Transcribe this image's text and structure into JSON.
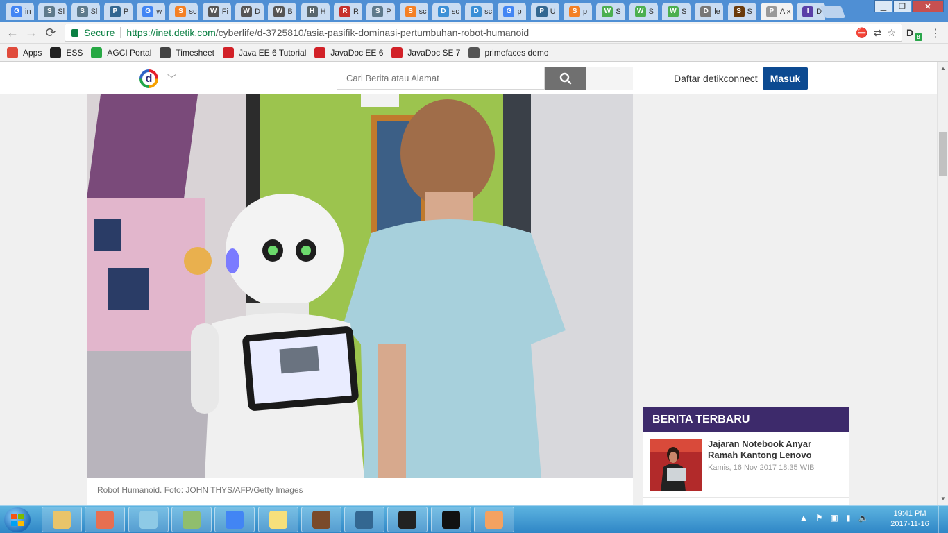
{
  "browser": {
    "tabs": [
      {
        "icon": "google-icon",
        "title": "in",
        "color": "#4285f4"
      },
      {
        "icon": "sonar-icon",
        "title": "Sl",
        "color": "#5e7a8c"
      },
      {
        "icon": "sonar-icon",
        "title": "Sl",
        "color": "#5e7a8c"
      },
      {
        "icon": "postgres-icon",
        "title": "P",
        "color": "#336791"
      },
      {
        "icon": "google-icon",
        "title": "w",
        "color": "#4285f4"
      },
      {
        "icon": "stackoverflow-icon",
        "title": "sc",
        "color": "#f48024"
      },
      {
        "icon": "wikipedia-icon",
        "title": "Fi",
        "color": "#555555"
      },
      {
        "icon": "wikipedia-icon",
        "title": "D",
        "color": "#555555"
      },
      {
        "icon": "wikipedia-icon",
        "title": "B",
        "color": "#555555"
      },
      {
        "icon": "hibernate-icon",
        "title": "H",
        "color": "#59666c"
      },
      {
        "icon": "redis-icon",
        "title": "R",
        "color": "#c6302b"
      },
      {
        "icon": "sonar-icon",
        "title": "P",
        "color": "#5e7a8c"
      },
      {
        "icon": "stackoverflow-icon",
        "title": "sc",
        "color": "#f48024"
      },
      {
        "icon": "db-icon",
        "title": "sc",
        "color": "#3a8fd6"
      },
      {
        "icon": "db-icon",
        "title": "sc",
        "color": "#3a8fd6"
      },
      {
        "icon": "google-icon",
        "title": "p",
        "color": "#4285f4"
      },
      {
        "icon": "postgres-icon",
        "title": "U",
        "color": "#336791"
      },
      {
        "icon": "stackoverflow-icon",
        "title": "p",
        "color": "#f48024"
      },
      {
        "icon": "w3-icon",
        "title": "S",
        "color": "#4caf50"
      },
      {
        "icon": "w3-icon",
        "title": "S",
        "color": "#4caf50"
      },
      {
        "icon": "w3-icon",
        "title": "S",
        "color": "#4caf50"
      },
      {
        "icon": "document-icon",
        "title": "le",
        "color": "#777777"
      },
      {
        "icon": "springio-icon",
        "title": "S",
        "color": "#6a3b0c"
      },
      {
        "icon": "page-icon",
        "title": "A",
        "color": "#999999",
        "active": true
      },
      {
        "icon": "info-icon",
        "title": "D",
        "color": "#5a3fa8"
      }
    ],
    "active_tab_close": "×",
    "window_controls": {
      "minimize": "▁",
      "maximize": "❐",
      "close": "✕"
    },
    "secure_label": "Secure",
    "url_host": "https://inet.detik.com",
    "url_path": "/cyberlife/d-3725810/asia-pasifik-dominasi-pertumbuhan-robot-humanoid",
    "extension_badge": "8",
    "bookmarks": [
      {
        "icon": "apps-grid-icon",
        "label": "Apps",
        "color": "#e04b3c"
      },
      {
        "icon": "ess-icon",
        "label": "ESS",
        "color": "#222222"
      },
      {
        "icon": "agci-icon",
        "label": "AGCI Portal",
        "color": "#27a844"
      },
      {
        "icon": "timesheet-icon",
        "label": "Timesheet",
        "color": "#444444"
      },
      {
        "icon": "oracle-icon",
        "label": "Java EE 6 Tutorial",
        "color": "#d22128"
      },
      {
        "icon": "oracle-icon",
        "label": "JavaDoc EE 6",
        "color": "#d22128"
      },
      {
        "icon": "oracle-icon",
        "label": "JavaDoc SE 7",
        "color": "#d22128"
      },
      {
        "icon": "primefaces-icon",
        "label": "primefaces demo",
        "color": "#555555"
      }
    ]
  },
  "site": {
    "logo_letter": "d",
    "search": {
      "placeholder": "Cari Berita atau Alamat"
    },
    "register_label": "Daftar detikconnect",
    "login_label": "Masuk",
    "login_color": "#0c4a91"
  },
  "article": {
    "photo_caption": "Robot Humanoid. Foto: JOHN THYS/AFP/Getty Images"
  },
  "sidebar": {
    "news_header": "BERITA TERBARU",
    "news_header_color": "#3d2a6b",
    "items": [
      {
        "title": "Jajaran Notebook Anyar Ramah Kantong Lenovo",
        "date": "Kamis, 16 Nov 2017 18:35 WIB"
      }
    ]
  },
  "taskbar": {
    "apps": [
      {
        "icon": "explorer-icon"
      },
      {
        "icon": "firefox-icon"
      },
      {
        "icon": "notes-icon"
      },
      {
        "icon": "text-editor-icon"
      },
      {
        "icon": "chrome-icon"
      },
      {
        "icon": "sticky-notes-icon"
      },
      {
        "icon": "java-ee-ide-icon"
      },
      {
        "icon": "pgadmin-icon"
      },
      {
        "icon": "eclipse-icon"
      },
      {
        "icon": "cmd-icon"
      },
      {
        "icon": "paint-icon"
      }
    ],
    "clock_time": "19:41 PM",
    "clock_date": "2017-11-16"
  }
}
